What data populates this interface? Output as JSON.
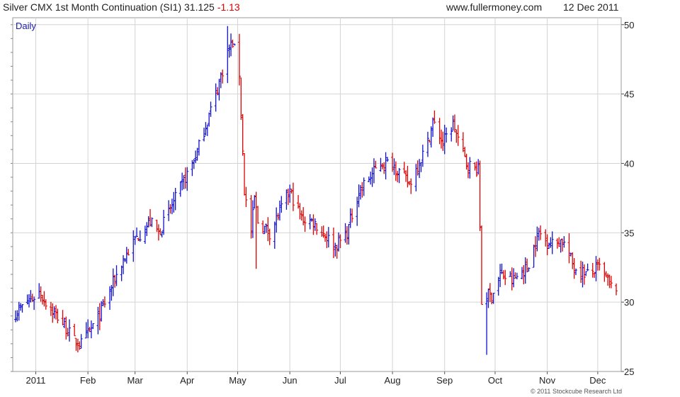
{
  "header": {
    "title": "Silver CMX 1st Month Continuation (SI1) 31.125",
    "change": "-1.13",
    "site": "www.fullermoney.com",
    "date": "12 Dec 2011"
  },
  "footer": {
    "copyright": "© 2011 Stockcube Research Ltd"
  },
  "chart_data": {
    "type": "line",
    "subtype": "daily price bars (OHLC)",
    "period_label": "Daily",
    "x_labels": [
      "2011",
      "Feb",
      "Mar",
      "Apr",
      "May",
      "Jun",
      "Jul",
      "Aug",
      "Sep",
      "Oct",
      "Nov",
      "Dec"
    ],
    "y_ticks": [
      25,
      30,
      35,
      40,
      45,
      50
    ],
    "ylim": [
      25,
      50.5
    ],
    "grid": true,
    "axis_side": "right",
    "colors": {
      "up": "#1010d0",
      "down": "#e00000",
      "grid": "#d4d4d4"
    },
    "series": [
      {
        "x": [
          "2010-12-20",
          "2011-01-03",
          "2011-01-10",
          "2011-01-17",
          "2011-01-24",
          "2011-01-28",
          "2011-02-07",
          "2011-02-21",
          "2011-03-01",
          "2011-03-10",
          "2011-03-15",
          "2011-03-24",
          "2011-04-06",
          "2011-04-18",
          "2011-04-25",
          "2011-04-28",
          "2011-05-02",
          "2011-05-05",
          "2011-05-09",
          "2011-05-11",
          "2011-05-13",
          "2011-05-20",
          "2011-06-01",
          "2011-06-08",
          "2011-06-15",
          "2011-06-28",
          "2011-07-05",
          "2011-07-12",
          "2011-07-25",
          "2011-08-01",
          "2011-08-11",
          "2011-08-22",
          "2011-08-25",
          "2011-08-31",
          "2011-09-06",
          "2011-09-14",
          "2011-09-21",
          "2011-09-22",
          "2011-09-23",
          "2011-09-26",
          "2011-09-29",
          "2011-10-04",
          "2011-10-11",
          "2011-10-20",
          "2011-10-27",
          "2011-11-04",
          "2011-11-10",
          "2011-11-17",
          "2011-11-25",
          "2011-12-02",
          "2011-12-09"
        ],
        "y": [
          29.2,
          30.7,
          29.5,
          28.5,
          27.2,
          27.0,
          28.8,
          32.8,
          34.5,
          35.8,
          35.0,
          37.2,
          40.5,
          45.0,
          48.0,
          48.7,
          46.5,
          38.0,
          35.0,
          37.5,
          35.8,
          35.0,
          38.0,
          36.0,
          35.8,
          34.0,
          35.0,
          38.0,
          40.0,
          40.0,
          38.5,
          41.5,
          43.0,
          41.5,
          42.8,
          40.0,
          39.5,
          35.5,
          30.0,
          30.5,
          30.5,
          32.0,
          31.5,
          32.5,
          35.0,
          34.2,
          34.5,
          32.5,
          32.0,
          32.5,
          31.1
        ]
      }
    ]
  }
}
